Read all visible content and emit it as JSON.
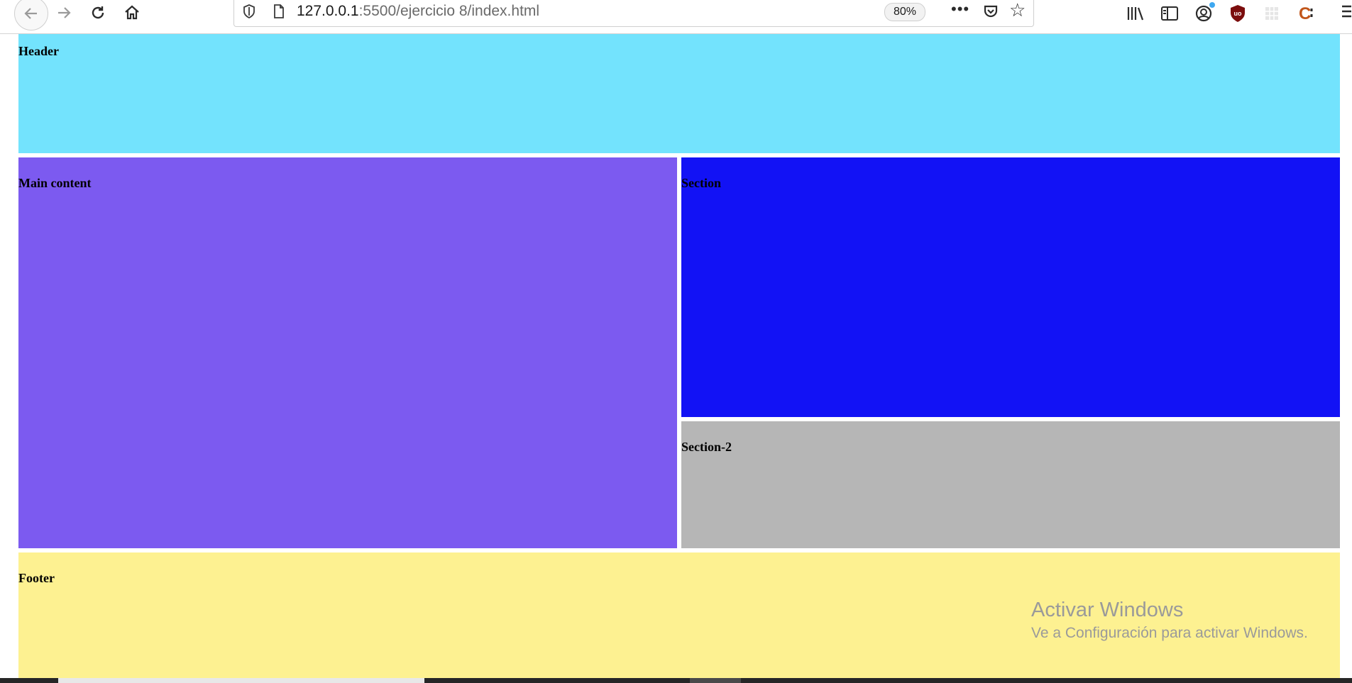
{
  "browser": {
    "url_host": "127.0.0.1",
    "url_rest": ":5500/ejercicio 8/index.html",
    "zoom": "80%",
    "more_label": "•••"
  },
  "icons": {
    "back": "back-arrow-icon",
    "forward": "forward-arrow-icon",
    "reload": "reload-icon",
    "home": "home-icon",
    "shield": "shield-icon",
    "page": "page-icon",
    "pocket": "pocket-icon",
    "star": "bookmark-star-icon",
    "library": "library-icon",
    "sidebar": "sidebar-icon",
    "account": "account-icon",
    "ublock": "ublock-icon",
    "extension": "extension-icon",
    "c_ext": "c-extension-icon",
    "menu": "hamburger-menu-icon"
  },
  "page": {
    "header": {
      "label": "Header",
      "color": "#73e3fd"
    },
    "main": {
      "label": "Main content",
      "color": "#7c5af0"
    },
    "section": {
      "label": "Section",
      "color": "#1212f5"
    },
    "section2": {
      "label": "Section-2",
      "color": "#b6b6b6"
    },
    "footer": {
      "label": "Footer",
      "color": "#fdf191"
    }
  },
  "watermark": {
    "title": "Activar Windows",
    "subtitle": "Ve a Configuración para activar Windows."
  }
}
